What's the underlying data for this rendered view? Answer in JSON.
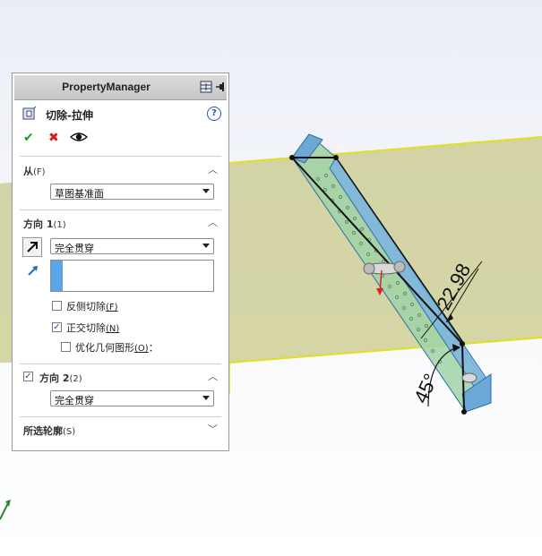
{
  "property_manager": {
    "title": "PropertyManager",
    "feature_title": "切除-拉伸",
    "help_label": "?",
    "actions": {
      "ok": "✔",
      "cancel": "✖"
    },
    "from": {
      "title": "从",
      "hotkey": "(F)",
      "value": "草图基准面"
    },
    "direction1": {
      "title": "方向 1",
      "hotkey": "(1)",
      "end_condition": "完全贯穿",
      "flip_side": {
        "label": "反侧切除",
        "hotkey": "(F)",
        "checked": false
      },
      "normal_cut": {
        "label": "正交切除",
        "hotkey": "(N)",
        "checked": true
      },
      "optimize": {
        "label": "优化几何图形",
        "hotkey": "(O)",
        "suffix": "：",
        "checked": false
      }
    },
    "direction2": {
      "title": "方向 2",
      "hotkey": "(2)",
      "checked": true,
      "end_condition": "完全贯穿"
    },
    "selected_contours": {
      "title": "所选轮廓",
      "hotkey": "(S)"
    }
  },
  "viewport": {
    "dimension_linear": "22.98",
    "dimension_angle": "45°"
  }
}
